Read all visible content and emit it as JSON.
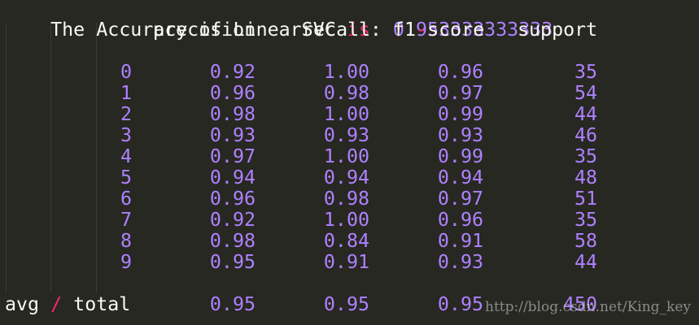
{
  "title_line": {
    "prefix": "The Accuracy of LinearSVC ",
    "keyword": "is",
    "colon": ": ",
    "value": "0.953333333333"
  },
  "headers": {
    "precision": "precision",
    "recall": "recall",
    "f1_part1": "f1",
    "f1_dash": "-",
    "f1_part2": "score",
    "support": "support"
  },
  "rows": [
    {
      "label": "0",
      "precision": "0.92",
      "recall": "1.00",
      "f1": "0.96",
      "support": "35"
    },
    {
      "label": "1",
      "precision": "0.96",
      "recall": "0.98",
      "f1": "0.97",
      "support": "54"
    },
    {
      "label": "2",
      "precision": "0.98",
      "recall": "1.00",
      "f1": "0.99",
      "support": "44"
    },
    {
      "label": "3",
      "precision": "0.93",
      "recall": "0.93",
      "f1": "0.93",
      "support": "46"
    },
    {
      "label": "4",
      "precision": "0.97",
      "recall": "1.00",
      "f1": "0.99",
      "support": "35"
    },
    {
      "label": "5",
      "precision": "0.94",
      "recall": "0.94",
      "f1": "0.94",
      "support": "48"
    },
    {
      "label": "6",
      "precision": "0.96",
      "recall": "0.98",
      "f1": "0.97",
      "support": "51"
    },
    {
      "label": "7",
      "precision": "0.92",
      "recall": "1.00",
      "f1": "0.96",
      "support": "35"
    },
    {
      "label": "8",
      "precision": "0.98",
      "recall": "0.84",
      "f1": "0.91",
      "support": "58"
    },
    {
      "label": "9",
      "precision": "0.95",
      "recall": "0.91",
      "f1": "0.93",
      "support": "44"
    }
  ],
  "avg": {
    "label_part1": "avg ",
    "slash": "/",
    "label_part2": " total",
    "precision": "0.95",
    "recall": "0.95",
    "f1": "0.95",
    "support": "450"
  },
  "watermark": "http://blog.csdn.net/King_key",
  "colors": {
    "background": "#272822",
    "text": "#f8f8f2",
    "number": "#ae81ff",
    "keyword": "#f92672"
  }
}
